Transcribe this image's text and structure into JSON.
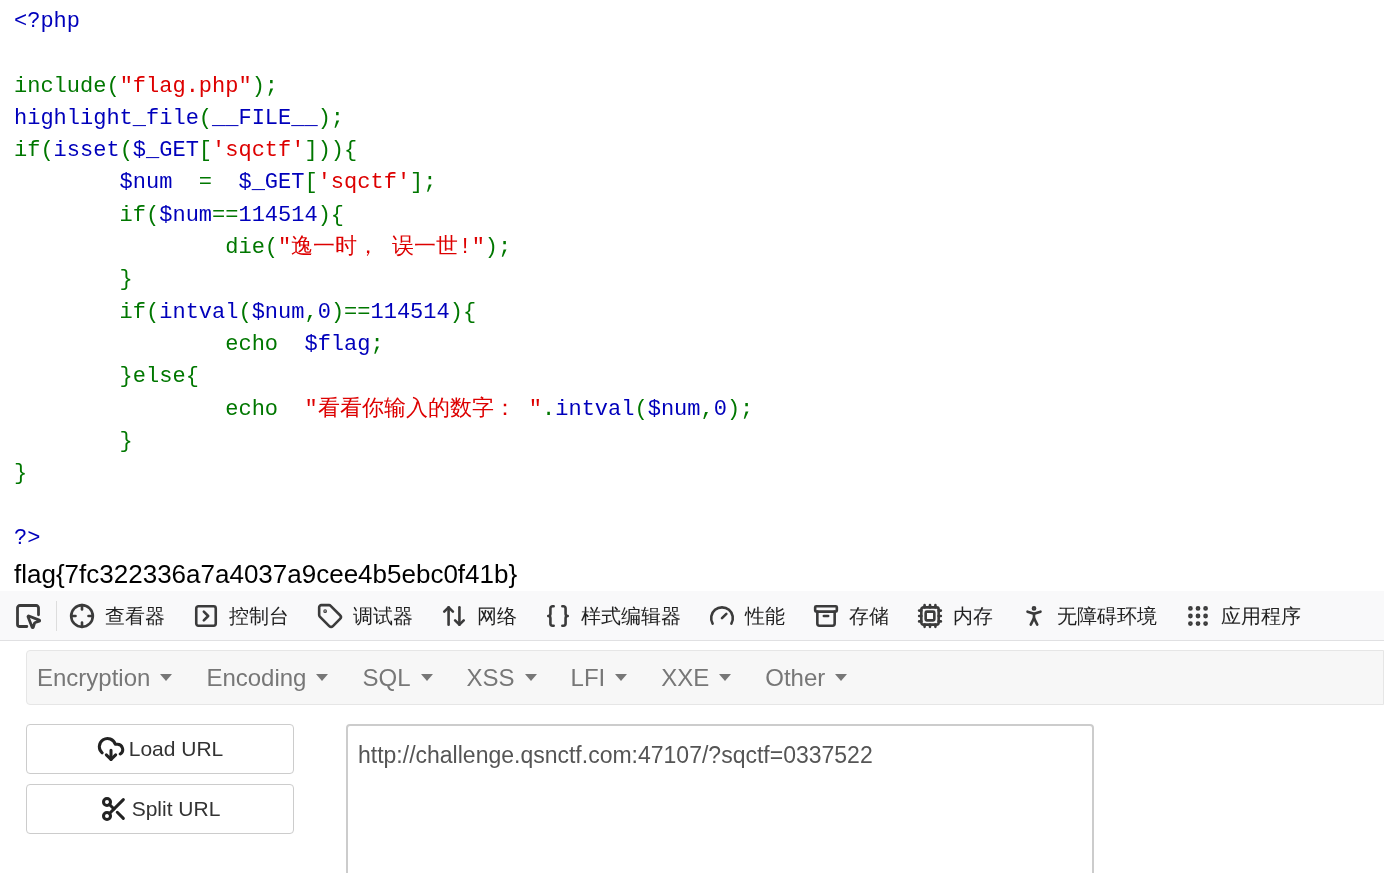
{
  "source_code": {
    "lines": [
      {
        "blank_before": false,
        "tokens": [
          {
            "kind": "name",
            "text": "<?php"
          }
        ]
      },
      {
        "blank_before": true,
        "tokens": [
          {
            "kind": "keyword",
            "text": "include("
          },
          {
            "kind": "string",
            "text": "\"flag.php\""
          },
          {
            "kind": "keyword",
            "text": ");"
          }
        ]
      },
      {
        "blank_before": false,
        "tokens": [
          {
            "kind": "name",
            "text": "highlight_file"
          },
          {
            "kind": "keyword",
            "text": "("
          },
          {
            "kind": "name",
            "text": "__FILE__"
          },
          {
            "kind": "keyword",
            "text": ");"
          }
        ]
      },
      {
        "blank_before": false,
        "tokens": [
          {
            "kind": "keyword",
            "text": "if("
          },
          {
            "kind": "name",
            "text": "isset"
          },
          {
            "kind": "keyword",
            "text": "("
          },
          {
            "kind": "name",
            "text": "$_GET"
          },
          {
            "kind": "keyword",
            "text": "["
          },
          {
            "kind": "string",
            "text": "'sqctf'"
          },
          {
            "kind": "keyword",
            "text": "])){"
          }
        ]
      },
      {
        "blank_before": false,
        "tokens": [
          {
            "kind": "name",
            "text": "        $num  "
          },
          {
            "kind": "keyword",
            "text": "=  "
          },
          {
            "kind": "name",
            "text": "$_GET"
          },
          {
            "kind": "keyword",
            "text": "["
          },
          {
            "kind": "string",
            "text": "'sqctf'"
          },
          {
            "kind": "keyword",
            "text": "];"
          }
        ]
      },
      {
        "blank_before": false,
        "tokens": [
          {
            "kind": "keyword",
            "text": "        if("
          },
          {
            "kind": "name",
            "text": "$num"
          },
          {
            "kind": "keyword",
            "text": "=="
          },
          {
            "kind": "name",
            "text": "114514"
          },
          {
            "kind": "keyword",
            "text": "){"
          }
        ]
      },
      {
        "blank_before": false,
        "tokens": [
          {
            "kind": "keyword",
            "text": "                die("
          },
          {
            "kind": "string",
            "text": "\"逸一时， 误一世!\""
          },
          {
            "kind": "keyword",
            "text": ");"
          }
        ]
      },
      {
        "blank_before": false,
        "tokens": [
          {
            "kind": "keyword",
            "text": "        }"
          }
        ]
      },
      {
        "blank_before": false,
        "tokens": [
          {
            "kind": "keyword",
            "text": "        if("
          },
          {
            "kind": "name",
            "text": "intval"
          },
          {
            "kind": "keyword",
            "text": "("
          },
          {
            "kind": "name",
            "text": "$num"
          },
          {
            "kind": "keyword",
            "text": ","
          },
          {
            "kind": "name",
            "text": "0"
          },
          {
            "kind": "keyword",
            "text": ")=="
          },
          {
            "kind": "name",
            "text": "114514"
          },
          {
            "kind": "keyword",
            "text": "){"
          }
        ]
      },
      {
        "blank_before": false,
        "tokens": [
          {
            "kind": "keyword",
            "text": "                echo  "
          },
          {
            "kind": "name",
            "text": "$flag"
          },
          {
            "kind": "keyword",
            "text": ";"
          }
        ]
      },
      {
        "blank_before": false,
        "tokens": [
          {
            "kind": "keyword",
            "text": "        }else{"
          }
        ]
      },
      {
        "blank_before": false,
        "tokens": [
          {
            "kind": "keyword",
            "text": "                echo  "
          },
          {
            "kind": "string",
            "text": "\"看看你输入的数字： \""
          },
          {
            "kind": "keyword",
            "text": "."
          },
          {
            "kind": "name",
            "text": "intval"
          },
          {
            "kind": "keyword",
            "text": "("
          },
          {
            "kind": "name",
            "text": "$num"
          },
          {
            "kind": "keyword",
            "text": ","
          },
          {
            "kind": "name",
            "text": "0"
          },
          {
            "kind": "keyword",
            "text": ");"
          }
        ]
      },
      {
        "blank_before": false,
        "tokens": [
          {
            "kind": "keyword",
            "text": "        }"
          }
        ]
      },
      {
        "blank_before": false,
        "tokens": [
          {
            "kind": "keyword",
            "text": "}"
          }
        ]
      },
      {
        "blank_before": true,
        "tokens": [
          {
            "kind": "name",
            "text": "?>"
          }
        ]
      }
    ]
  },
  "output": "flag{7fc322336a7a4037a9cee4b5ebc0f41b}",
  "devtools": {
    "tabs": [
      {
        "label": "查看器",
        "selected": false
      },
      {
        "label": "控制台",
        "selected": false
      },
      {
        "label": "调试器",
        "selected": false
      },
      {
        "label": "网络",
        "selected": false
      },
      {
        "label": "样式编辑器",
        "selected": false
      },
      {
        "label": "性能",
        "selected": false
      },
      {
        "label": "存储",
        "selected": false
      },
      {
        "label": "内存",
        "selected": false
      },
      {
        "label": "无障碍环境",
        "selected": false
      },
      {
        "label": "应用程序",
        "selected": false
      }
    ]
  },
  "hackbar": {
    "menus": [
      "Encryption",
      "Encoding",
      "SQL",
      "XSS",
      "LFI",
      "XXE",
      "Other"
    ],
    "buttons": [
      "Load URL",
      "Split URL"
    ],
    "url": "http://challenge.qsnctf.com:47107/?sqctf=0337522"
  }
}
